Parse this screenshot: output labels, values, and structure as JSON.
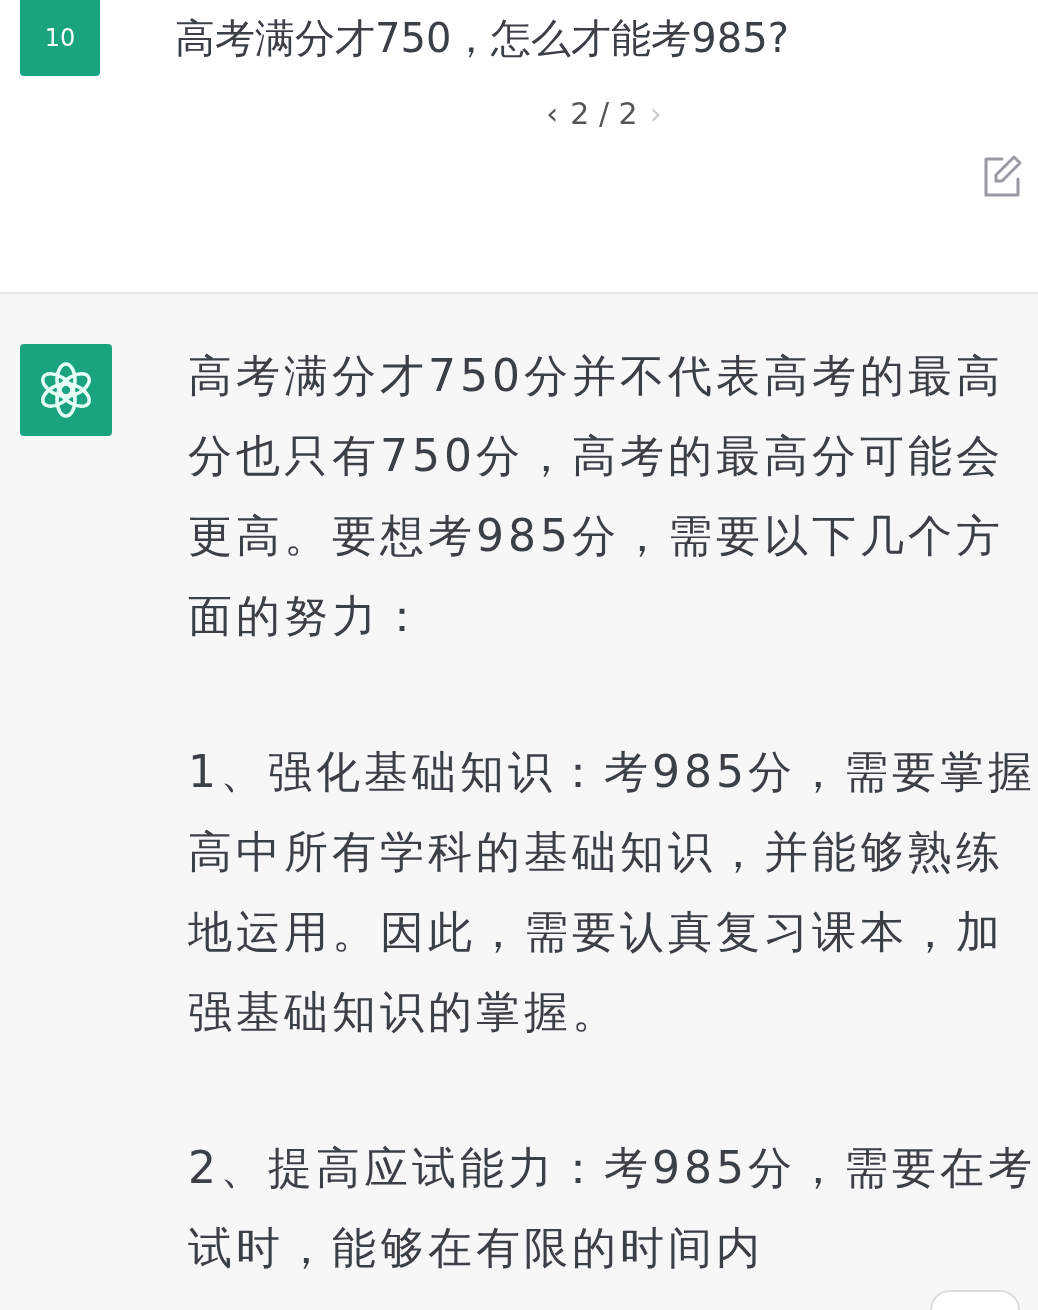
{
  "user_message": {
    "avatar_text": "10",
    "text": "高考满分才750，怎么才能考985?",
    "pager": {
      "prev": "‹",
      "label": "2 / 2",
      "next": "›",
      "next_disabled": true
    }
  },
  "assistant_message": {
    "paragraphs": [
      "高考满分才750分并不代表高考的最高分也只有750分，高考的最高分可能会更高。要想考985分，需要以下几个方面的努力：",
      "1、强化基础知识：考985分，需要掌握高中所有学科的基础知识，并能够熟练地运用。因此，需要认真复习课本，加强基础知识的掌握。",
      "2、提高应试能力：考985分，需要在考试时，能够在有限的时间内"
    ]
  }
}
